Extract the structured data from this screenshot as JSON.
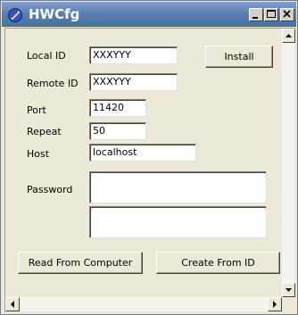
{
  "window": {
    "title": "HWCfg"
  },
  "form": {
    "local_id_label": "Local ID",
    "local_id_value": "XXXYYY",
    "remote_id_label": "Remote ID",
    "remote_id_value": "XXXYYY",
    "port_label": "Port",
    "port_value": "11420",
    "repeat_label": "Repeat",
    "repeat_value": "50",
    "host_label": "Host",
    "host_value": "localhost",
    "password_label": "Password",
    "password_value_1": "",
    "password_value_2": ""
  },
  "buttons": {
    "install": "Install",
    "read_from_computer": "Read From Computer",
    "create_from_id": "Create From ID"
  },
  "icons": {
    "app": "app-logo-icon",
    "minimize": "minimize-icon",
    "maximize": "maximize-icon",
    "close": "close-icon",
    "scroll_up": "arrow-up-icon",
    "scroll_down": "arrow-down-icon",
    "scroll_left": "arrow-left-icon",
    "scroll_right": "arrow-right-icon"
  }
}
